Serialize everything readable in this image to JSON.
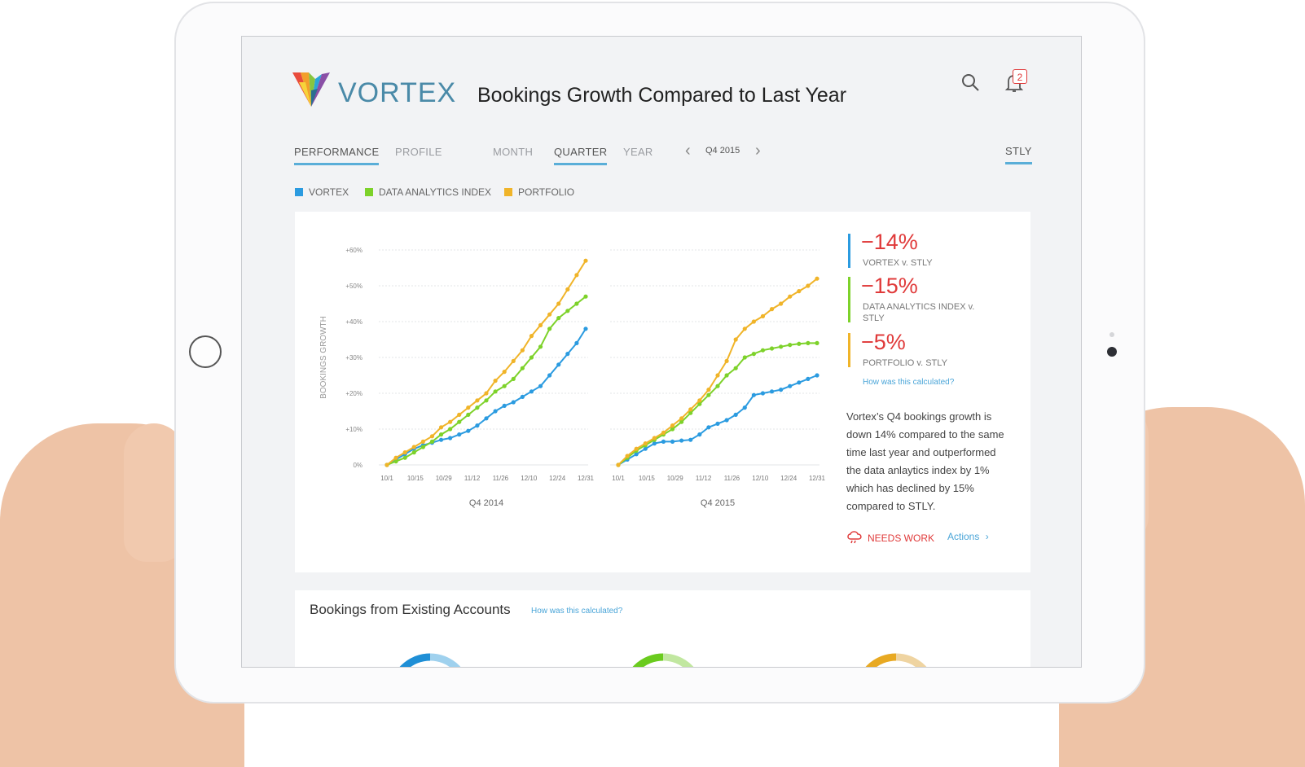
{
  "app": {
    "brand": "VORTEX",
    "title": "Bookings Growth Compared to Last Year",
    "notification_count": "2"
  },
  "tabs": [
    {
      "label": "PERFORMANCE",
      "active": true
    },
    {
      "label": "PROFILE",
      "active": false
    }
  ],
  "periods": [
    {
      "label": "MONTH",
      "active": false
    },
    {
      "label": "QUARTER",
      "active": true
    },
    {
      "label": "YEAR",
      "active": false
    }
  ],
  "period_nav": {
    "label": "Q4 2015",
    "prev_icon": "chevron-left-icon",
    "next_icon": "chevron-right-icon"
  },
  "compare": {
    "label": "STLY",
    "active": true
  },
  "legend": [
    {
      "label": "VORTEX",
      "color": "#2b9be0"
    },
    {
      "label": "DATA ANALYTICS INDEX",
      "color": "#7dd22a"
    },
    {
      "label": "PORTFOLIO",
      "color": "#f0b429"
    }
  ],
  "chart_data": [
    {
      "type": "line",
      "title": "Q4 2014",
      "ylabel": "BOOKINGS GROWTH",
      "ylim": [
        0,
        60
      ],
      "yticks": [
        "0%",
        "+10%",
        "+20%",
        "+30%",
        "+40%",
        "+50%",
        "+60%"
      ],
      "xticks": [
        "10/1",
        "10/15",
        "10/29",
        "11/12",
        "11/26",
        "12/10",
        "12/24",
        "12/31"
      ],
      "x": [
        1,
        2,
        3,
        4,
        5,
        6,
        7,
        8,
        9,
        10,
        11,
        12,
        13,
        14,
        15,
        16,
        17,
        18,
        19,
        20,
        21,
        22,
        23
      ],
      "series": [
        {
          "name": "VORTEX",
          "color": "#2b9be0",
          "values": [
            0,
            1.5,
            3,
            4.5,
            5.5,
            6.2,
            7,
            7.5,
            8.5,
            9.5,
            11,
            13,
            15,
            16.5,
            17.5,
            19,
            20.5,
            22,
            25,
            28,
            31,
            34,
            38
          ]
        },
        {
          "name": "DATA ANALYTICS INDEX",
          "color": "#7dd22a",
          "values": [
            0,
            1,
            2,
            3.5,
            5,
            6.5,
            8.5,
            10,
            12,
            14,
            16,
            18,
            20.5,
            22,
            24,
            27,
            30,
            33,
            38,
            41,
            43,
            45,
            47
          ]
        },
        {
          "name": "PORTFOLIO",
          "color": "#f0b429",
          "values": [
            0,
            2,
            3.5,
            5,
            6.5,
            8,
            10.5,
            12,
            14,
            16,
            18,
            20,
            23.5,
            26,
            29,
            32,
            36,
            39,
            42,
            45,
            49,
            53,
            57
          ]
        }
      ]
    },
    {
      "type": "line",
      "title": "Q4 2015",
      "ylim": [
        0,
        60
      ],
      "xticks": [
        "10/1",
        "10/15",
        "10/29",
        "11/12",
        "11/26",
        "12/10",
        "12/24",
        "12/31"
      ],
      "x": [
        1,
        2,
        3,
        4,
        5,
        6,
        7,
        8,
        9,
        10,
        11,
        12,
        13,
        14,
        15,
        16,
        17,
        18,
        19,
        20,
        21,
        22,
        23
      ],
      "series": [
        {
          "name": "VORTEX",
          "color": "#2b9be0",
          "values": [
            0,
            1.5,
            3,
            4.5,
            6,
            6.5,
            6.5,
            6.8,
            7,
            8.5,
            10.5,
            11.5,
            12.5,
            14,
            16,
            19.5,
            20,
            20.5,
            21,
            22,
            23,
            24,
            25
          ]
        },
        {
          "name": "DATA ANALYTICS INDEX",
          "color": "#7dd22a",
          "values": [
            0,
            2,
            4,
            5.5,
            7,
            8.5,
            10,
            12,
            14.5,
            17,
            19.5,
            22,
            25,
            27,
            30,
            31,
            32,
            32.5,
            33,
            33.5,
            33.8,
            34,
            34
          ]
        },
        {
          "name": "PORTFOLIO",
          "color": "#f0b429",
          "values": [
            0,
            2.5,
            4.5,
            6,
            7.5,
            9,
            11,
            13,
            15.5,
            18,
            21,
            25,
            29,
            35,
            38,
            40,
            41.5,
            43.5,
            45,
            47,
            48.5,
            50,
            52
          ]
        }
      ]
    }
  ],
  "stats": [
    {
      "value": "−14%",
      "label": "VORTEX v. STLY",
      "color": "#2b9be0"
    },
    {
      "value": "−15%",
      "label": "DATA ANALYTICS INDEX v. STLY",
      "color": "#7dd22a"
    },
    {
      "value": "−5%",
      "label": "PORTFOLIO v. STLY",
      "color": "#f0b429"
    }
  ],
  "calc_link": "How was this calculated?",
  "description": "Vortex’s Q4 bookings growth is down 14% compared to the same time last year and outperformed the data anlaytics index by 1% which has declined by 15% compared to STLY.",
  "status": {
    "label": "NEEDS WORK",
    "icon": "storm-cloud-icon"
  },
  "actions": {
    "label": "Actions"
  },
  "section2": {
    "title": "Bookings from Existing Accounts",
    "link": "How was this calculated?",
    "donuts": [
      {
        "color": "#1f8fd6",
        "light": "#9fd1ee"
      },
      {
        "color": "#6acb1e",
        "light": "#c1e7a0"
      },
      {
        "color": "#e8a922",
        "light": "#efd4a1"
      }
    ]
  }
}
